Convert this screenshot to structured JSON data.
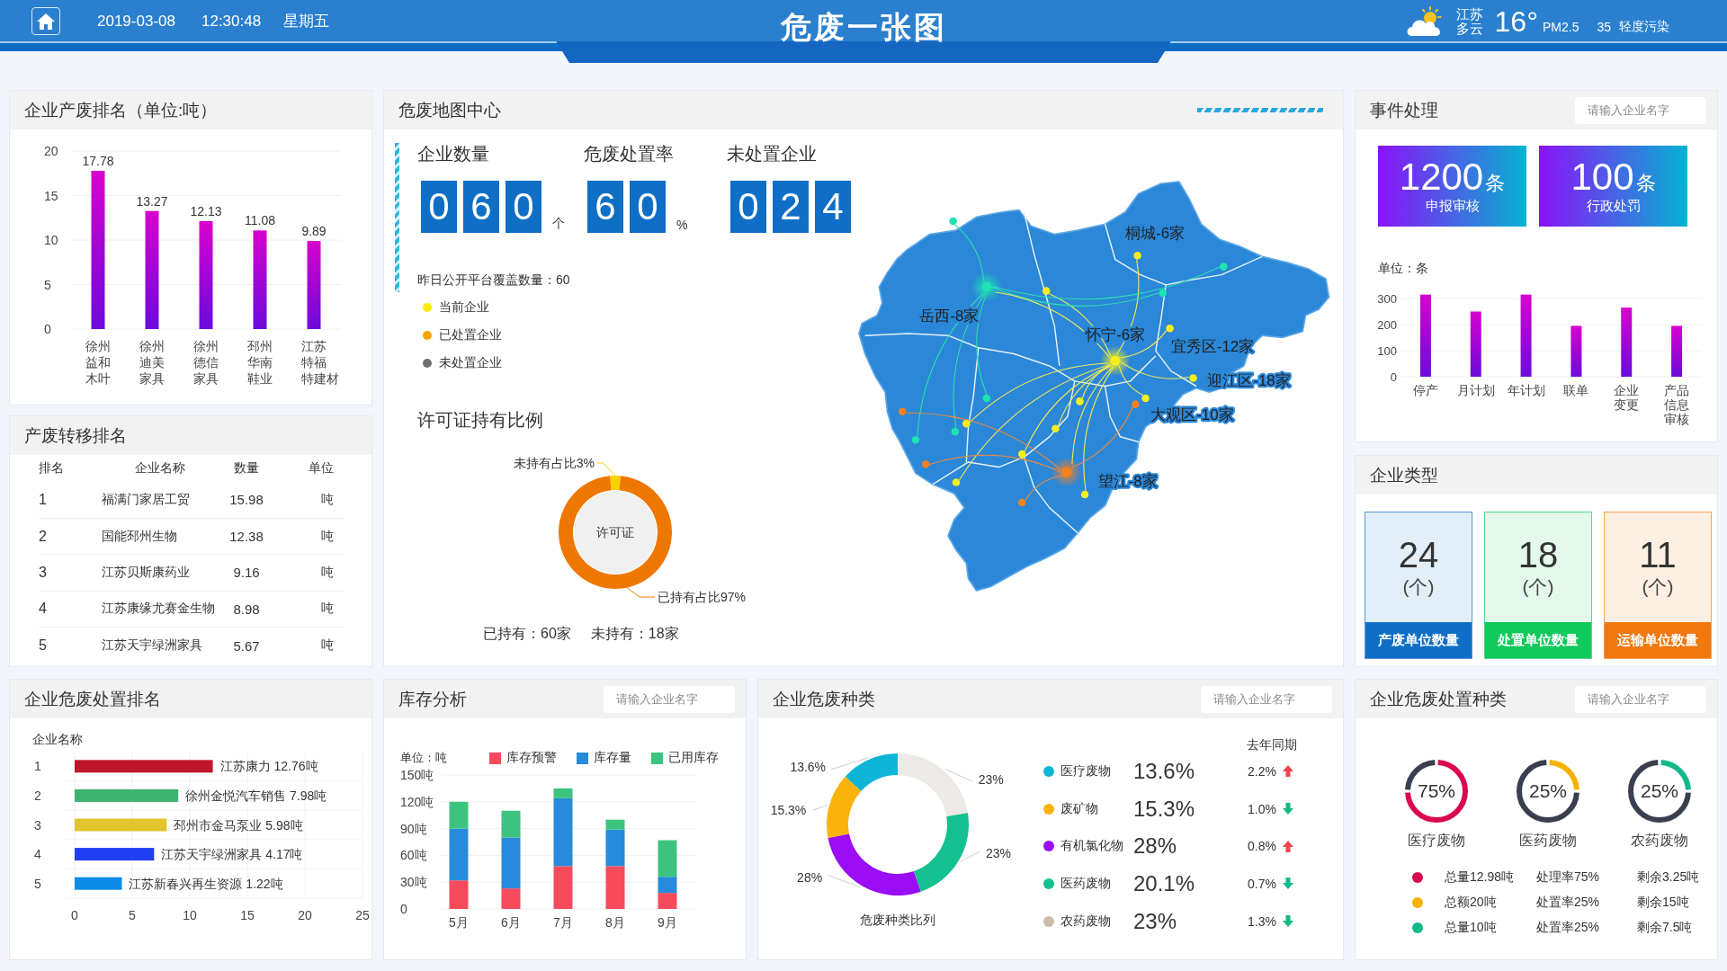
{
  "header": {
    "date": "2019-03-08",
    "time": "12:30:48",
    "weekday": "星期五",
    "title": "危废一张图",
    "weather": {
      "region": "江苏",
      "condition": "多云",
      "temperature": "16°",
      "pm_label": "PM2.5",
      "pm_value": "35",
      "air_quality": "轻度污染"
    }
  },
  "waste_ranking": {
    "title": "企业产废排名（单位:吨）",
    "chart_data": {
      "type": "bar",
      "categories": [
        "徐州益和木叶",
        "徐州迪美家具",
        "徐州德信家具",
        "邳州华南鞋业",
        "江苏特福特建材"
      ],
      "values": [
        17.78,
        13.27,
        12.13,
        11.08,
        9.89
      ],
      "ylim": [
        0,
        20
      ],
      "yticks": [
        {
          "value": 0,
          "label": "0"
        },
        {
          "value": 5,
          "label": "5"
        },
        {
          "value": 10,
          "label": "10"
        },
        {
          "value": 15,
          "label": "15"
        },
        {
          "value": 20,
          "label": "20"
        }
      ],
      "grid": true,
      "data_labels": true
    }
  },
  "map_center": {
    "title": "危废地图中心",
    "stats": [
      {
        "label": "企业数量",
        "value": "060",
        "unit": "个"
      },
      {
        "label": "危废处置率",
        "value": "60",
        "unit": "%"
      },
      {
        "label": "未处置企业",
        "value": "024"
      }
    ],
    "coverage": "昨日公开平台覆盖数量：60",
    "legend": [
      {
        "label": "当前企业",
        "color": "#f7ec00"
      },
      {
        "label": "已处置企业",
        "color": "#f5a300"
      },
      {
        "label": "未处置企业",
        "color": "#6f6f6f"
      }
    ],
    "permit": {
      "title": "许可证持有比例",
      "center_label": "许可证",
      "chart_data": {
        "type": "donut",
        "values": [
          3,
          97
        ],
        "colors": [
          "#f8d300",
          "#ee7700"
        ],
        "value_labels": [
          "未持有占比3%",
          "已持有占比97%"
        ]
      },
      "summary": [
        "已持有：60家",
        "未持有：18家"
      ]
    },
    "map": {
      "labels": [
        "桐城-6家",
        "岳西-8家",
        "怀宁-6家",
        "宜秀区-12家",
        "迎江区-18家",
        "大观区-10家",
        "望江-8家"
      ]
    }
  },
  "events": {
    "title": "事件处理",
    "search": {
      "placeholder": "请输入企业名字"
    },
    "cards": [
      {
        "value": "1200",
        "unit": "条",
        "label": "申报审核"
      },
      {
        "value": "100",
        "unit": "条",
        "label": "行政处罚"
      }
    ],
    "chart_data": {
      "type": "bar",
      "ylabel": "单位：条",
      "categories": [
        "停产",
        "月计划",
        "年计划",
        "联单",
        "企业变更",
        "产品信息审核"
      ],
      "values": [
        315,
        250,
        315,
        195,
        265,
        195
      ],
      "ylim": [
        0,
        320
      ],
      "yticks": [
        {
          "value": 0,
          "label": "0"
        },
        {
          "value": 100,
          "label": "100"
        },
        {
          "value": 200,
          "label": "200"
        },
        {
          "value": 300,
          "label": "300"
        }
      ],
      "grid": true
    }
  },
  "transfer_ranking": {
    "title": "产废转移排名",
    "columns": [
      "排名",
      "企业名称",
      "数量",
      "单位"
    ],
    "rows": [
      [
        "1",
        "福满门家居工贸",
        "15.98",
        "吨"
      ],
      [
        "2",
        "国能邳州生物",
        "12.38",
        "吨"
      ],
      [
        "3",
        "江苏贝斯康药业",
        "9.16",
        "吨"
      ],
      [
        "4",
        "江苏康缘尤赛金生物",
        "8.98",
        "吨"
      ],
      [
        "5",
        "江苏天宇绿洲家具",
        "5.67",
        "吨"
      ]
    ]
  },
  "enterprise_types": {
    "title": "企业类型",
    "cards": [
      {
        "count": "24",
        "unit": "(个)",
        "label": "产废单位数量",
        "color": "#0f6fc6"
      },
      {
        "count": "18",
        "unit": "(个)",
        "label": "处置单位数量",
        "color": "#0fc95b"
      },
      {
        "count": "11",
        "unit": "(个)",
        "label": "运输单位数量",
        "color": "#f0780f"
      }
    ]
  },
  "disposal_ranking": {
    "title": "企业危废处置排名",
    "chart_data": {
      "type": "bar",
      "orientation": "horizontal",
      "ylabel": "企业名称",
      "categories": [
        "1",
        "2",
        "3",
        "4",
        "5"
      ],
      "values": [
        12.0,
        9.0,
        8.0,
        6.9,
        4.1
      ],
      "colors": [
        "#c0162b",
        "#3cb371",
        "#e2c52e",
        "#1f3ff5",
        "#0a8be8"
      ],
      "value_labels": [
        "江苏康力 12.76吨",
        "徐州金悦汽车销售 7.98吨",
        "邳州市金马泵业 5.98吨",
        "江苏天宇绿洲家具 4.17吨",
        "江苏新春兴再生资源 1.22吨"
      ],
      "xlim": [
        0,
        25
      ],
      "xticks": [
        {
          "value": 0,
          "label": "0"
        },
        {
          "value": 5,
          "label": "5"
        },
        {
          "value": 10,
          "label": "10"
        },
        {
          "value": 15,
          "label": "15"
        },
        {
          "value": 20,
          "label": "20"
        },
        {
          "value": 25,
          "label": "25"
        }
      ],
      "grid": true
    }
  },
  "inventory": {
    "title": "库存分析",
    "search": {
      "placeholder": "请输入企业名字"
    },
    "chart_data": {
      "type": "bar",
      "stacked": true,
      "legend": "top",
      "grid": true,
      "ylabel": "单位：吨",
      "categories": [
        "5月",
        "6月",
        "7月",
        "8月",
        "9月"
      ],
      "series": [
        {
          "name": "库存预警",
          "color": "#f74a5c",
          "values": [
            32,
            23,
            48,
            48,
            18
          ]
        },
        {
          "name": "库存量",
          "color": "#268bdc",
          "values": [
            58,
            57,
            76,
            41,
            18
          ]
        },
        {
          "name": "已用库存",
          "color": "#3cc47e",
          "values": [
            30,
            30,
            11,
            11,
            41
          ]
        }
      ],
      "ylim": [
        0,
        150
      ],
      "yticks": [
        {
          "value": 0,
          "label": "0"
        },
        {
          "value": 30,
          "label": "30吨"
        },
        {
          "value": 60,
          "label": "60吨"
        },
        {
          "value": 90,
          "label": "90吨"
        },
        {
          "value": 120,
          "label": "120吨"
        },
        {
          "value": 150,
          "label": "150吨"
        }
      ]
    }
  },
  "waste_types": {
    "title": "企业危废种类",
    "search": {
      "placeholder": "请输入企业名字"
    },
    "chart_data": {
      "type": "donut",
      "title": "危废种类比列",
      "values": [
        13.6,
        15.3,
        28,
        23,
        23
      ],
      "colors": [
        "#0cb5d6",
        "#f9b30b",
        "#9a0df5",
        "#13c08f",
        "#ede9e6"
      ],
      "value_labels": [
        "13.6%",
        "15.3%",
        "28%",
        "23%",
        "23%"
      ]
    },
    "compare_header": "去年同期",
    "items": [
      {
        "name": "医疗废物",
        "color": "#0cb5d6",
        "share": "13.6%",
        "change": "2.2%",
        "increase": true
      },
      {
        "name": "废矿物",
        "color": "#f9b30b",
        "share": "15.3%",
        "change": "1.0%",
        "increase": false
      },
      {
        "name": "有机氯化物",
        "color": "#9a0df5",
        "share": "28%",
        "change": "0.8%",
        "increase": true
      },
      {
        "name": "医药废物",
        "color": "#13c08f",
        "share": "20.1%",
        "change": "0.7%",
        "increase": false
      },
      {
        "name": "农药废物",
        "color": "#cbbca5",
        "share": "23%",
        "change": "1.3%",
        "increase": false
      }
    ]
  },
  "disposal_types": {
    "title": "企业危废处置种类",
    "search": {
      "placeholder": "请输入企业名字"
    },
    "rings": [
      {
        "name": "医疗废物",
        "reading": "75%",
        "color": "#d9084f"
      },
      {
        "name": "医药废物",
        "reading": "25%",
        "color": "#f7b100"
      },
      {
        "name": "农药废物",
        "reading": "25%",
        "color": "#13b98b"
      }
    ],
    "rows": [
      {
        "color": "#d9084f",
        "total": "总量12.98吨",
        "rate": "处理率75%",
        "remaining": "剩余3.25吨"
      },
      {
        "color": "#f7b100",
        "total": "总额20吨",
        "rate": "处置率25%",
        "remaining": "剩余15吨"
      },
      {
        "color": "#13b98b",
        "total": "总量10吨",
        "rate": "处置率25%",
        "remaining": "剩余7.5吨"
      }
    ]
  }
}
